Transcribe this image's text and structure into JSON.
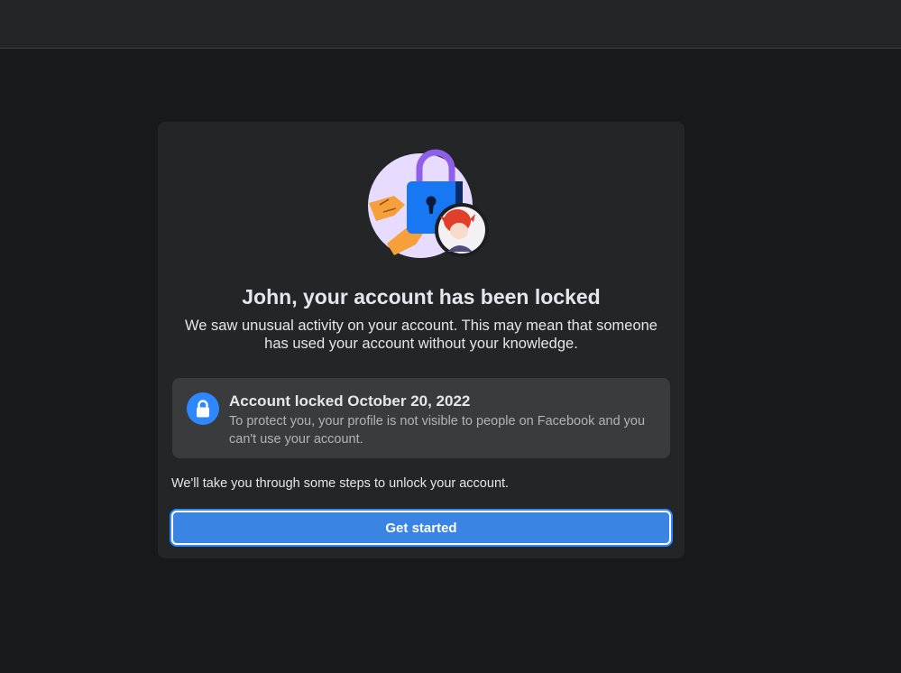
{
  "card": {
    "title": "John, your account has been locked",
    "subtitle": "We saw unusual activity on your account. This may mean that someone has used your account without your knowledge.",
    "lock_notice": {
      "title": "Account locked October 20, 2022",
      "description": "To protect you, your profile is not visible to people on Facebook and you can't use your account.",
      "icon": "lock-icon"
    },
    "steps_text": "We'll take you through some steps to unlock your account.",
    "cta_label": "Get started"
  },
  "colors": {
    "background": "#18191a",
    "card": "#242526",
    "accent": "#2d88ff",
    "button": "#3a85e4"
  }
}
